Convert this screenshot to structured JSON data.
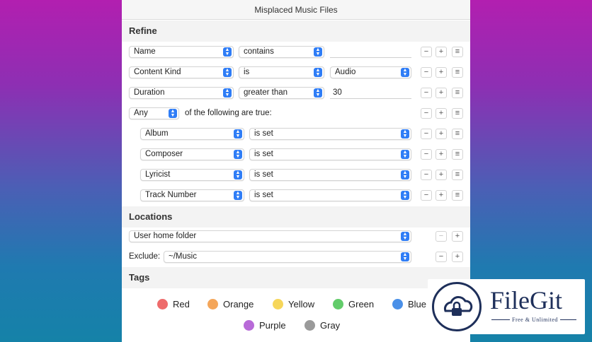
{
  "window": {
    "title": "Misplaced Music Files"
  },
  "refine": {
    "heading": "Refine",
    "rows": [
      {
        "attribute": "Name",
        "operator": "contains",
        "value": ""
      },
      {
        "attribute": "Content Kind",
        "operator": "is",
        "value": "Audio"
      },
      {
        "attribute": "Duration",
        "operator": "greater than",
        "value": "30"
      }
    ],
    "group": {
      "quantifier": "Any",
      "text": "of the following are true:",
      "rows": [
        {
          "attribute": "Album",
          "operator": "is set"
        },
        {
          "attribute": "Composer",
          "operator": "is set"
        },
        {
          "attribute": "Lyricist",
          "operator": "is set"
        },
        {
          "attribute": "Track Number",
          "operator": "is set"
        }
      ]
    },
    "buttons": {
      "minus": "−",
      "plus": "+",
      "menu": "≡"
    }
  },
  "locations": {
    "heading": "Locations",
    "folder": "User home folder",
    "exclude_label": "Exclude:",
    "exclude_value": "~/Music"
  },
  "tags": {
    "heading": "Tags",
    "items": [
      {
        "label": "Red",
        "color": "#ee6b6b"
      },
      {
        "label": "Orange",
        "color": "#f4a65a"
      },
      {
        "label": "Yellow",
        "color": "#f6d65a"
      },
      {
        "label": "Green",
        "color": "#62cc6a"
      },
      {
        "label": "Blue",
        "color": "#4a90e8"
      },
      {
        "label": "Purple",
        "color": "#b86ad8"
      },
      {
        "label": "Gray",
        "color": "#9a9a9a"
      }
    ]
  },
  "watermark": {
    "brand": "FileGit",
    "tagline": "Free & Unlimited"
  }
}
